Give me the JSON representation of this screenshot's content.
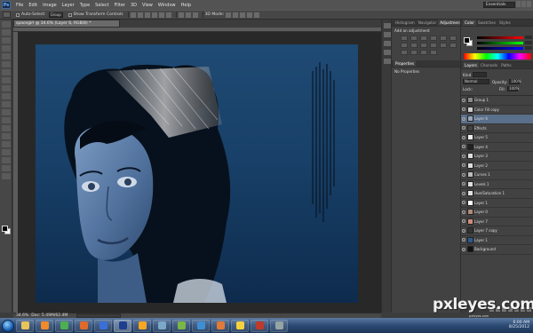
{
  "app": {
    "logo_text": "Ps"
  },
  "menu": {
    "items": [
      "File",
      "Edit",
      "Image",
      "Layer",
      "Type",
      "Select",
      "Filter",
      "3D",
      "View",
      "Window",
      "Help"
    ]
  },
  "workspace_select": "Essentials",
  "options_bar": {
    "auto_select_label": "Auto-Select:",
    "auto_select_value": "Group",
    "transform_label": "Show Transform Controls",
    "mode_3d_label": "3D Mode:"
  },
  "document": {
    "tab_title": "spacegirl @ 34.6% (Layer 6, RGB/8) *",
    "zoom": "34.6%",
    "doc_size": "Doc: 5.49M/62.4M"
  },
  "adjustments_panel": {
    "tabs": [
      "Histogram",
      "Navigator",
      "Adjustments"
    ],
    "active_tab": 2,
    "add_label": "Add an adjustment",
    "properties_tab": "Properties",
    "no_properties": "No Properties"
  },
  "color_panel": {
    "tabs": [
      "Color",
      "Swatches",
      "Styles"
    ],
    "active_tab": 0
  },
  "layers_panel": {
    "tabs": [
      "Layers",
      "Channels",
      "Paths"
    ],
    "active_tab": 0,
    "kind_label": "Kind",
    "blend_mode": "Normal",
    "opacity_label": "Opacity:",
    "opacity_value": "100%",
    "lock_label": "Lock:",
    "fill_label": "Fill:",
    "fill_value": "100%",
    "layers": [
      {
        "name": "Group 1",
        "thumb": "#888888",
        "active": false
      },
      {
        "name": "Color Fill copy",
        "thumb": "#cccccc",
        "active": false
      },
      {
        "name": "Layer 6",
        "thumb": "#9aa7b5",
        "active": true
      },
      {
        "name": "Effects",
        "thumb": "#424242",
        "active": false
      },
      {
        "name": "Layer 5",
        "thumb": "#eeeeee",
        "active": false
      },
      {
        "name": "Layer 4",
        "thumb": "#222222",
        "active": false
      },
      {
        "name": "Layer 3",
        "thumb": "#dddddd",
        "active": false
      },
      {
        "name": "Layer 2",
        "thumb": "#dddddd",
        "active": false
      },
      {
        "name": "Curves 1",
        "thumb": "#bbbbbb",
        "active": false
      },
      {
        "name": "Levels 1",
        "thumb": "#dddddd",
        "active": false
      },
      {
        "name": "Hue/Saturation 1",
        "thumb": "#e0e0e0",
        "active": false
      },
      {
        "name": "Layer 1",
        "thumb": "#ffffff",
        "active": false
      },
      {
        "name": "Layer 0",
        "thumb": "#b08a7a",
        "active": false
      },
      {
        "name": "Layer 7",
        "thumb": "#d08c7a",
        "active": false
      },
      {
        "name": "Layer 7 copy",
        "thumb": "#333333",
        "active": false
      },
      {
        "name": "Layer 1",
        "thumb": "#2d5b8f",
        "active": false
      },
      {
        "name": "Background",
        "thumb": "#111111",
        "active": false
      }
    ]
  },
  "taskbar": {
    "apps": [
      {
        "name": "folder",
        "color": "#e8c45a"
      },
      {
        "name": "media-player",
        "color": "#f08a2a"
      },
      {
        "name": "chrome",
        "color": "#4caf50"
      },
      {
        "name": "firefox",
        "color": "#e06a2a"
      },
      {
        "name": "browser",
        "color": "#3a6ed8"
      },
      {
        "name": "photoshop",
        "color": "#1c3f8f"
      },
      {
        "name": "illustrator",
        "color": "#f5a623"
      },
      {
        "name": "bridge",
        "color": "#7ba8c8"
      },
      {
        "name": "app-green",
        "color": "#7ab648"
      },
      {
        "name": "app-blue",
        "color": "#3d8fd1"
      },
      {
        "name": "app-orange",
        "color": "#e07b39"
      },
      {
        "name": "app-yellow",
        "color": "#f5d23d"
      },
      {
        "name": "app-red",
        "color": "#c0392b"
      },
      {
        "name": "app-gray",
        "color": "#95a5a6"
      }
    ],
    "active_index": 5,
    "clock": "6:00 AM",
    "date": "8/25/2012"
  },
  "watermark": {
    "text": "pxleyes.com",
    "sub": "pxleyes.com"
  }
}
